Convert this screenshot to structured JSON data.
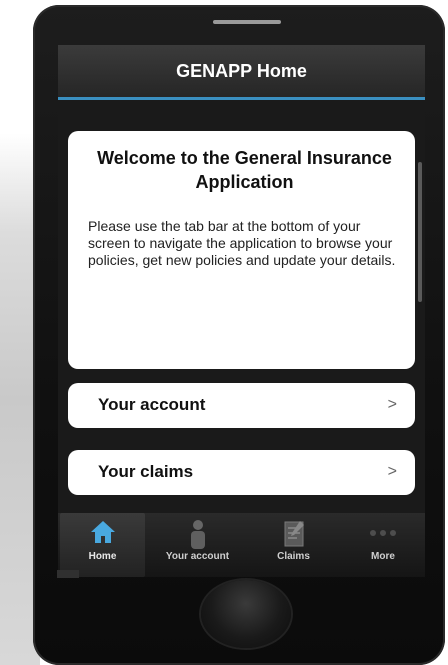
{
  "navbar": {
    "title": "GENAPP Home"
  },
  "welcome": {
    "title": "Welcome to the General Insurance Application",
    "body": "Please use the tab bar at the bottom of your screen to navigate the application to browse your policies, get new policies and update your details."
  },
  "list": {
    "items": [
      {
        "label": "Your account",
        "chevron": ">"
      },
      {
        "label": "Your claims",
        "chevron": ">"
      }
    ]
  },
  "tabbar": {
    "tabs": [
      {
        "label": "Home",
        "icon": "home-icon",
        "active": true
      },
      {
        "label": "Your account",
        "icon": "person-icon",
        "active": false
      },
      {
        "label": "Claims",
        "icon": "document-icon",
        "active": false
      },
      {
        "label": "More",
        "icon": "more-dots-icon",
        "active": false
      }
    ]
  },
  "colors": {
    "accent": "#3a8fc0",
    "home_icon": "#49a9e0",
    "navbar_bg": "#2f2f2f"
  }
}
